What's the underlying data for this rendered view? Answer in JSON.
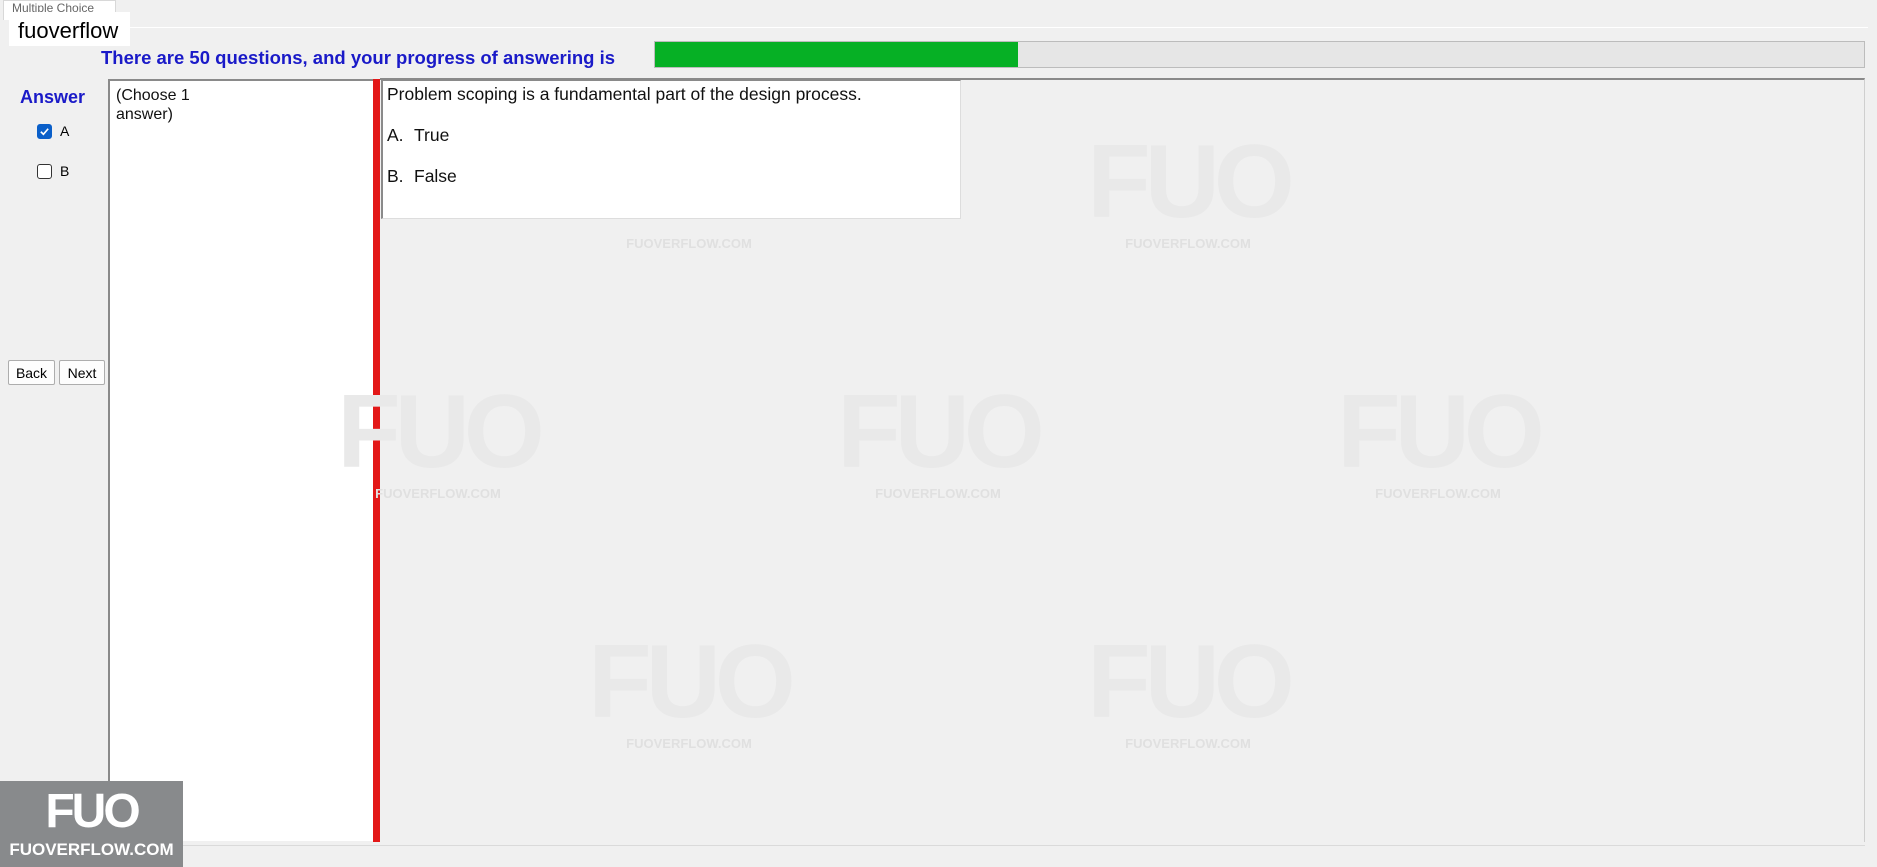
{
  "window": {
    "title_fragment": "Multiple Choice"
  },
  "brand": {
    "label": "fuoverflow"
  },
  "progress": {
    "text": "There are 50 questions, and your progress of answering is",
    "fraction": 0.3,
    "fill_color": "#06b025"
  },
  "answer": {
    "title": "Answer",
    "options": [
      {
        "label": "A",
        "checked": true
      },
      {
        "label": "B",
        "checked": false
      }
    ]
  },
  "nav": {
    "back_label": "Back",
    "next_label": "Next"
  },
  "instruction": {
    "text": "(Choose 1 answer)"
  },
  "question": {
    "text": "Problem scoping is a fundamental part of the design process.",
    "choices": [
      {
        "letter": "A.",
        "text": "True"
      },
      {
        "letter": "B.",
        "text": "False"
      }
    ]
  },
  "watermark": {
    "logo": "FUO",
    "site": "FUOVERFLOW.COM"
  },
  "badge": {
    "logo": "FUO",
    "site": "FUOVERFLOW.COM"
  },
  "colors": {
    "accent_text": "#1a1ac8",
    "divider": "#e31818",
    "checkbox_checked": "#0a5fc9"
  }
}
